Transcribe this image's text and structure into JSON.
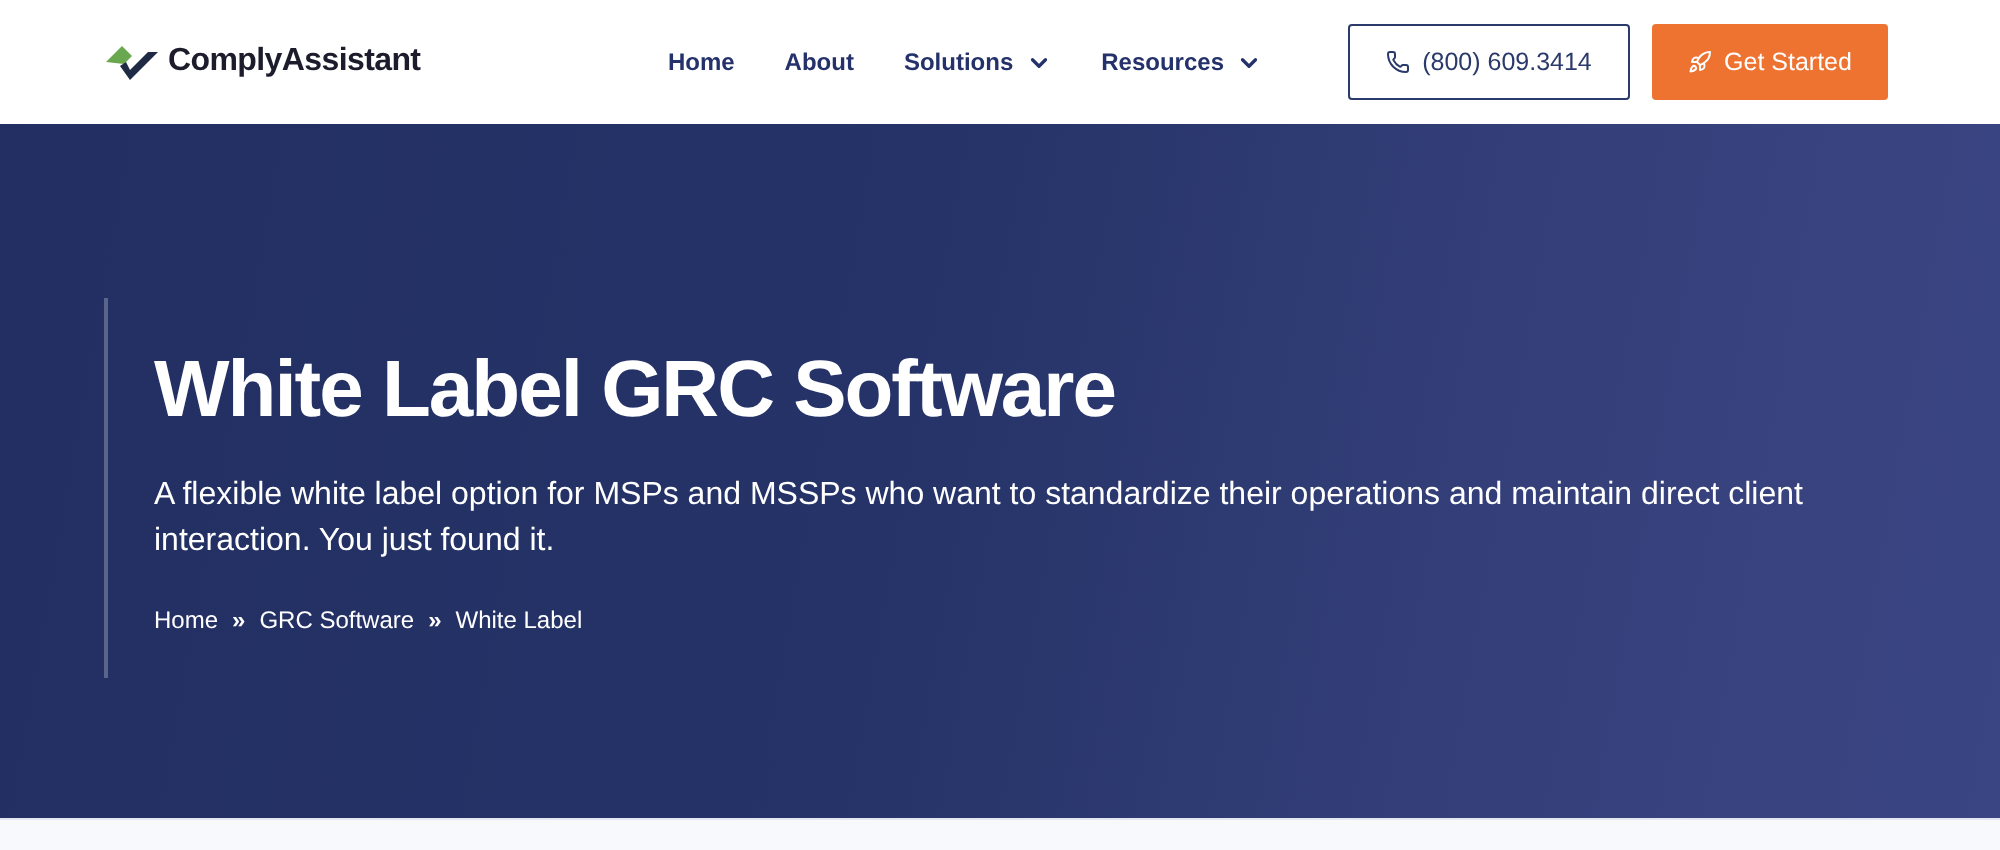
{
  "header": {
    "logo": "ComplyAssistant",
    "nav": [
      {
        "label": "Home",
        "has_menu": false
      },
      {
        "label": "About",
        "has_menu": false
      },
      {
        "label": "Solutions",
        "has_menu": true
      },
      {
        "label": "Resources",
        "has_menu": true
      }
    ],
    "phone_button": "(800) 609.3414",
    "cta_button": "Get Started"
  },
  "hero": {
    "title": "White Label GRC Software",
    "subtitle": "A flexible white label option for MSPs and MSSPs who want to standardize their operations and maintain direct client interaction. You just found it.",
    "breadcrumb": {
      "separator": "»",
      "items": [
        "Home",
        "GRC Software",
        "White Label"
      ]
    }
  }
}
